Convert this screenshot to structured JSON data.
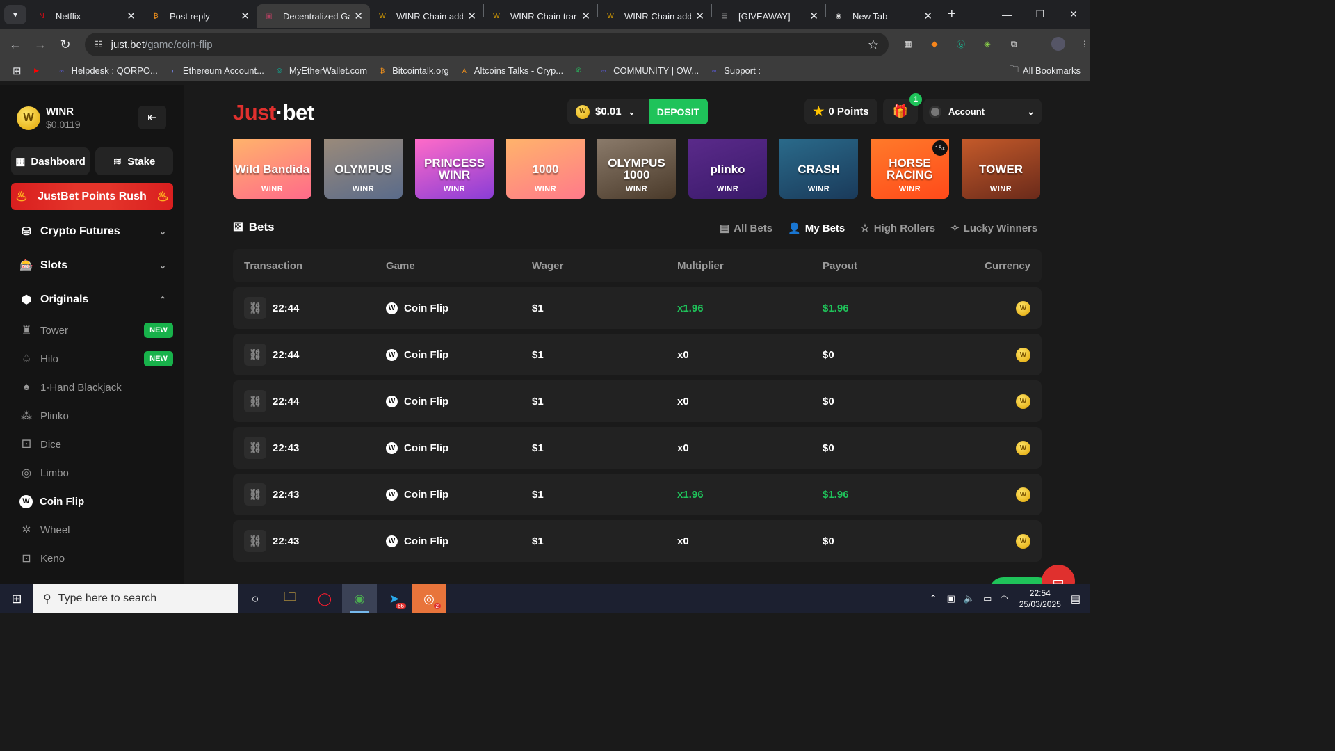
{
  "browser": {
    "tabs": [
      {
        "title": "Netflix",
        "icon": "N",
        "color": "#e50914",
        "active": false
      },
      {
        "title": "Post reply",
        "icon": "₿",
        "color": "#f7931a",
        "active": false
      },
      {
        "title": "Decentralized Ga",
        "icon": "▣",
        "color": "#b04060",
        "active": true
      },
      {
        "title": "WINR Chain add",
        "icon": "W",
        "color": "#e0a300",
        "active": false
      },
      {
        "title": "WINR Chain tran",
        "icon": "W",
        "color": "#e0a300",
        "active": false
      },
      {
        "title": "WINR Chain add",
        "icon": "W",
        "color": "#e0a300",
        "active": false
      },
      {
        "title": "[GIVEAWAY]",
        "icon": "▤",
        "color": "#999",
        "active": false
      },
      {
        "title": "New Tab",
        "icon": "◉",
        "color": "#ddd",
        "active": false
      }
    ],
    "url_host": "just.bet",
    "url_path": "/game/coin-flip",
    "bookmarks": [
      {
        "label": "",
        "icon": "▶",
        "color": "#ff0000"
      },
      {
        "label": "Helpdesk : QORPO...",
        "icon": "∞",
        "color": "#5b5bd6"
      },
      {
        "label": "Ethereum Account...",
        "icon": "◐",
        "color": "#6e7bd0"
      },
      {
        "label": "MyEtherWallet.com",
        "icon": "◎",
        "color": "#05c0a5"
      },
      {
        "label": "Bitcointalk.org",
        "icon": "₿",
        "color": "#f7931a"
      },
      {
        "label": "Altcoins Talks - Cryp...",
        "icon": "A",
        "color": "#f7931a"
      },
      {
        "label": "",
        "icon": "✆",
        "color": "#25d366"
      },
      {
        "label": "COMMUNITY |  OW...",
        "icon": "∞",
        "color": "#5b5bd6"
      },
      {
        "label": "Support :",
        "icon": "∞",
        "color": "#5b5bd6"
      }
    ],
    "all_bookmarks": "All Bookmarks"
  },
  "sidebar": {
    "brand_name": "WINR",
    "brand_price": "$0.0119",
    "dashboard": "Dashboard",
    "stake": "Stake",
    "rush": "JustBet Points Rush",
    "sections": [
      "Crypto Futures",
      "Slots",
      "Originals"
    ],
    "originals": [
      {
        "label": "Tower",
        "badge": "NEW"
      },
      {
        "label": "Hilo",
        "badge": "NEW"
      },
      {
        "label": "1-Hand Blackjack",
        "badge": ""
      },
      {
        "label": "Plinko",
        "badge": ""
      },
      {
        "label": "Dice",
        "badge": ""
      },
      {
        "label": "Limbo",
        "badge": ""
      },
      {
        "label": "Coin Flip",
        "badge": ""
      },
      {
        "label": "Wheel",
        "badge": ""
      },
      {
        "label": "Keno",
        "badge": ""
      }
    ]
  },
  "header": {
    "logo_a": "Just",
    "logo_b": "·bet",
    "balance": "$0.01",
    "deposit": "DEPOSIT",
    "points": "0 Points",
    "gift_count": "1",
    "account": "Account"
  },
  "games": [
    {
      "title": "Wild Bandida",
      "label": "WINR",
      "bg": "linear-gradient(160deg,#ffb36b,#ff6a8a)"
    },
    {
      "title": "OLYMPUS",
      "label": "WINR",
      "bg": "linear-gradient(160deg,#9a8a7a,#5a6b8a)"
    },
    {
      "title": "PRINCESS WINR",
      "label": "WINR",
      "bg": "linear-gradient(160deg,#ff6bc8,#8a3dd6)"
    },
    {
      "title": "1000",
      "label": "WINR",
      "bg": "linear-gradient(160deg,#ffb36b,#ff7a8a)"
    },
    {
      "title": "OLYMPUS 1000",
      "label": "WINR",
      "bg": "linear-gradient(160deg,#8a7a6a,#4a3a2a)"
    },
    {
      "title": "plinko",
      "label": "WINR",
      "bg": "linear-gradient(160deg,#5a2a8a,#3a1a6a)"
    },
    {
      "title": "CRASH",
      "label": "WINR",
      "bg": "linear-gradient(160deg,#2a6a8a,#1a3a5a)"
    },
    {
      "title": "HORSE RACING",
      "label": "WINR",
      "bg": "linear-gradient(160deg,#ff7a2a,#ff4a1a)",
      "tag": "15x"
    },
    {
      "title": "TOWER",
      "label": "WINR",
      "bg": "linear-gradient(160deg,#c45a2a,#6a2a1a)"
    }
  ],
  "bets": {
    "title": "Bets",
    "tabs": [
      "All Bets",
      "My Bets",
      "High Rollers",
      "Lucky Winners"
    ],
    "active_tab": "My Bets",
    "columns": [
      "Transaction",
      "Game",
      "Wager",
      "Multiplier",
      "Payout",
      "Currency"
    ],
    "rows": [
      {
        "time": "22:44",
        "game": "Coin Flip",
        "wager": "$1",
        "multiplier": "x1.96",
        "payout": "$1.96",
        "win": true
      },
      {
        "time": "22:44",
        "game": "Coin Flip",
        "wager": "$1",
        "multiplier": "x0",
        "payout": "$0",
        "win": false
      },
      {
        "time": "22:44",
        "game": "Coin Flip",
        "wager": "$1",
        "multiplier": "x0",
        "payout": "$0",
        "win": false
      },
      {
        "time": "22:43",
        "game": "Coin Flip",
        "wager": "$1",
        "multiplier": "x0",
        "payout": "$0",
        "win": false
      },
      {
        "time": "22:43",
        "game": "Coin Flip",
        "wager": "$1",
        "multiplier": "x1.96",
        "payout": "$1.96",
        "win": true
      },
      {
        "time": "22:43",
        "game": "Coin Flip",
        "wager": "$1",
        "multiplier": "x0",
        "payout": "$0",
        "win": false
      }
    ]
  },
  "taskbar": {
    "search_placeholder": "Type here to search",
    "time": "22:54",
    "date": "25/03/2025",
    "telegram_badge": "66",
    "discord_badge": "2"
  }
}
